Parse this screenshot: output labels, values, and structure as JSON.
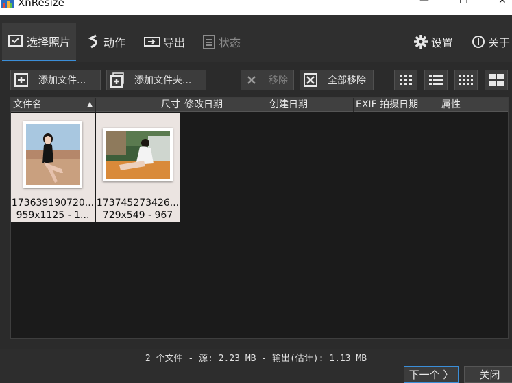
{
  "window": {
    "title": "XnResize",
    "minimize_glyph": "—",
    "maximize_glyph": "☐",
    "close_glyph": "✕"
  },
  "tabs": [
    {
      "label": "选择照片",
      "icon": "select-photos-icon",
      "active": true
    },
    {
      "label": "动作",
      "icon": "actions-icon"
    },
    {
      "label": "导出",
      "icon": "export-icon"
    },
    {
      "label": "状态",
      "icon": "status-icon",
      "disabled": true
    },
    {
      "label": "设置",
      "icon": "gear-icon"
    },
    {
      "label": "关于",
      "icon": "info-icon"
    }
  ],
  "toolbar": {
    "add_files": "添加文件...",
    "add_folder": "添加文件夹...",
    "remove": "移除",
    "remove_all": "全部移除"
  },
  "columns": [
    "文件名",
    "尺寸",
    "修改日期",
    "创建日期",
    "EXIF 拍摄日期",
    "属性"
  ],
  "files": [
    {
      "name": "173639190720...",
      "info": "959x1125 - 1..."
    },
    {
      "name": "173745273426...",
      "info": "729x549 - 967"
    }
  ],
  "status": "2 个文件 - 源: 2.23 MB - 输出(估计): 1.13 MB",
  "buttons": {
    "next": "下一个 〉",
    "close": "关闭"
  },
  "colors": {
    "accent": "#3b8ed8",
    "background": "#2d2d2d",
    "list_background": "#1b1b1b",
    "thumb_background": "#ebe4e1"
  }
}
